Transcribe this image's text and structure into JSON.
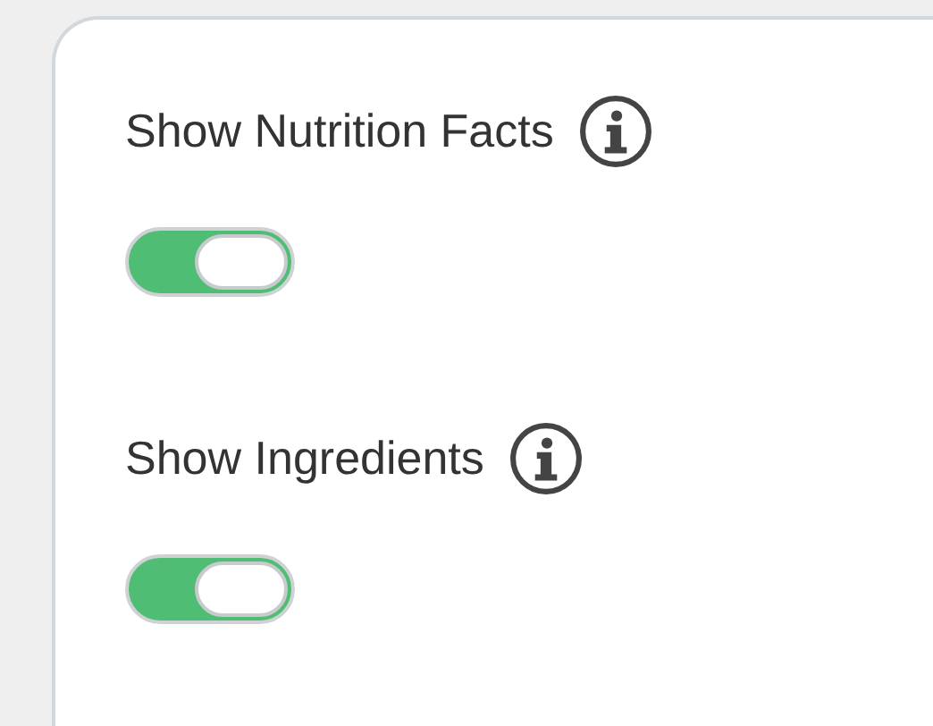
{
  "settings": [
    {
      "label": "Show Nutrition Facts",
      "on": true
    },
    {
      "label": "Show Ingredients",
      "on": true
    }
  ]
}
